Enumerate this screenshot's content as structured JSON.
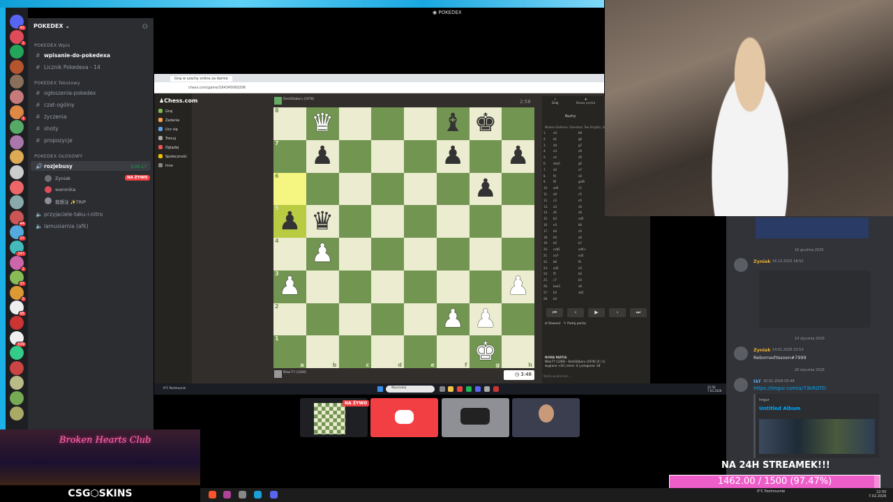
{
  "discord": {
    "window_title": "POKEDEX",
    "server_name": "POKEDEX",
    "server_badges": [
      "42",
      "1",
      "",
      "",
      "",
      "",
      "1",
      "",
      "",
      "",
      "",
      "",
      "",
      "44",
      "37",
      "147",
      "1",
      "37",
      "5",
      "95",
      "",
      "539",
      "",
      "",
      "",
      "",
      ""
    ],
    "categories": {
      "wpis": "POKEDEX Wpis",
      "tekst": "POKEDEX Tekstowy",
      "glos": "POKEDEX GŁOSOWY"
    },
    "channels_wpis": [
      "wpisanie-do-pokedexa",
      "Licznik Pokedexa - 14"
    ],
    "channels_tekst": [
      "ogłoszenia-pokedex",
      "czat-ogólny",
      "życzenia",
      "shoty",
      "propozycje"
    ],
    "voice_active": "rozjebusy",
    "voice_timer": "3:05:17",
    "voice_live_badge": "NA ŻYWO",
    "voice_users": [
      "Zyniak",
      "waronika",
      "我想注 ✨TRIP"
    ],
    "voice_other": [
      "przyjaciele-taku-i-nitro",
      "lamusiarnia (afk)"
    ]
  },
  "browser": {
    "tab_title": "Graj w szachy online za darmo",
    "url": "chess.com/game/164345060206"
  },
  "chess": {
    "logo": "Chess.com",
    "nav": [
      "Graj",
      "Zadania",
      "Ucz się",
      "Trenuj",
      "Oglądaj",
      "Społeczność",
      "Inne"
    ],
    "opponent": "DeshDabaru (1978)",
    "opponent_clock": "2:58",
    "player": "Nitar77 (1266)",
    "player_clock": "3:48",
    "panel_tabs": [
      "Graj",
      "Nowa partia"
    ],
    "panel_header": "Ruchy",
    "opening": "Modern Defense: Standard, Two Knights, Suttles",
    "moves": [
      [
        "1.",
        "e4",
        "b6"
      ],
      [
        "2.",
        "b1",
        "g6"
      ],
      [
        "3.",
        "d4",
        "g7"
      ],
      [
        "4.",
        "e3",
        "e6"
      ],
      [
        "5.",
        "c4",
        "d5"
      ],
      [
        "6.",
        "dxe5",
        "g5"
      ],
      [
        "7.",
        "d3",
        "e7"
      ],
      [
        "8.",
        "f4",
        "c8"
      ],
      [
        "9.",
        "f6",
        "gxf6"
      ],
      [
        "10.",
        "xe6",
        "c5"
      ],
      [
        "11.",
        "d4",
        "c5"
      ],
      [
        "12.",
        "c3",
        "e5"
      ],
      [
        "13.",
        "a3",
        "a6"
      ],
      [
        "14.",
        "d1",
        "a6"
      ],
      [
        "15.",
        "b3",
        "xd5"
      ],
      [
        "16.",
        "e3",
        "b6"
      ],
      [
        "17.",
        "b4",
        "c6"
      ],
      [
        "18.",
        "b4",
        "a6"
      ],
      [
        "19.",
        "b5",
        "b7"
      ],
      [
        "20.",
        "cxb5",
        "xd4+"
      ],
      [
        "21.",
        "xa7",
        "xd3"
      ],
      [
        "22.",
        "b6",
        "f6"
      ],
      [
        "23.",
        "xd3",
        "e5"
      ],
      [
        "24.",
        "f5",
        "b4"
      ],
      [
        "25.",
        "c7",
        "b5"
      ],
      [
        "26.",
        "bxe3",
        "a6"
      ],
      [
        "27.",
        "b5",
        "xb5"
      ],
      [
        "28.",
        "b4",
        ""
      ]
    ],
    "controls": [
      "⏮",
      "‹",
      "▶",
      "›",
      "⏭"
    ],
    "rematch": "Rewanż",
    "share": "Podaj partię",
    "game_info_title": "NOWA PARTIA",
    "game_info": "Nitar77 (1266) - DeshDabaru (1978) (0 | 1)",
    "game_info2": "wygrana +16 | remis -4 | przegrana -18",
    "chat_placeholder": "Wyślij wiadomość...",
    "ranks": [
      "8",
      "7",
      "6",
      "5",
      "4",
      "3",
      "2",
      "1"
    ],
    "files": [
      "a",
      "b",
      "c",
      "d",
      "e",
      "f",
      "g",
      "h"
    ],
    "board": [
      [
        "",
        "Q",
        "",
        "",
        "",
        "b",
        "k",
        ""
      ],
      [
        "",
        "p",
        "",
        "",
        "",
        "p",
        "",
        "p"
      ],
      [
        "",
        "",
        "",
        "",
        "",
        "",
        "p",
        ""
      ],
      [
        "p",
        "q",
        "",
        "",
        "",
        "",
        "",
        ""
      ],
      [
        "",
        "P",
        "",
        "",
        "",
        "",
        "",
        ""
      ],
      [
        "P",
        "",
        "",
        "",
        "",
        "",
        "",
        "P"
      ],
      [
        "",
        "",
        "",
        "",
        "",
        "P",
        "P",
        ""
      ],
      [
        "",
        "",
        "",
        "",
        "",
        "",
        "K",
        ""
      ]
    ]
  },
  "taskbar": {
    "weather": "0°C Pochmurnie",
    "search": "Wyszukaj",
    "time": "22:50",
    "date": "7.02.2026"
  },
  "tiles": {
    "live": "NA ŻYWO"
  },
  "right_chat": {
    "date1": "16 grudnia 2025",
    "msg1_name": "Zyniak",
    "msg1_time": "16.12.2025 18:52",
    "date2": "14 stycznia 2026",
    "msg2_name": "Zyniak",
    "msg2_time": "14.01.2026 23:53",
    "msg2_text": "RebornedYasoen#7999",
    "date3": "20 stycznia 2026",
    "msg3_name": "tkf",
    "msg3_time": "20.01.2026 03:48",
    "msg3_link": "https://imgur.com/a/73kROTD",
    "embed_site": "Imgur",
    "embed_title": "Untitled Album"
  },
  "overlay": {
    "promo_title": "Broken Hearts Club",
    "brand": "CSG⬡SKINS",
    "goal_text": "NA 24H STREAMEK!!!",
    "goal_value": "1462.00 / 1500 (97.47%)",
    "goal_fraction": 0.9747
  },
  "win_taskbar": {
    "weather": "0°C Pochmurnie",
    "time": "22:50",
    "date": "7.02.2026"
  },
  "colors": {
    "discord_bg": "#2b2d31",
    "chess_light": "#ebecd0",
    "chess_dark": "#739552",
    "goal_pink": "#ee5ec9",
    "live_red": "#f23f43"
  }
}
